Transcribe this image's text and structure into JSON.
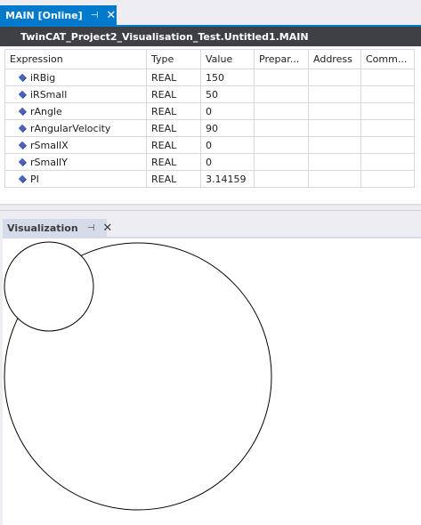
{
  "doc_tab": {
    "title": "MAIN [Online]",
    "pin_glyph": "⊣",
    "close_glyph": "✕"
  },
  "path_title": "TwinCAT_Project2_Visualisation_Test.Untitled1.MAIN",
  "watch": {
    "columns": [
      "Expression",
      "Type",
      "Value",
      "Prepar...",
      "Address",
      "Comm..."
    ],
    "rows": [
      {
        "expression": "iRBig",
        "type": "REAL",
        "value": "150"
      },
      {
        "expression": "iRSmall",
        "type": "REAL",
        "value": "50"
      },
      {
        "expression": "rAngle",
        "type": "REAL",
        "value": "0"
      },
      {
        "expression": "rAngularVelocity",
        "type": "REAL",
        "value": "90"
      },
      {
        "expression": "rSmallX",
        "type": "REAL",
        "value": "0"
      },
      {
        "expression": "rSmallY",
        "type": "REAL",
        "value": "0"
      },
      {
        "expression": "PI",
        "type": "REAL",
        "value": "3.14159"
      }
    ]
  },
  "visualization": {
    "title": "Visualization",
    "pin_glyph": "⊣",
    "close_glyph": "✕"
  },
  "colors": {
    "accent": "#007acc",
    "title_bar": "#3f3f46",
    "variable_icon": "#4a62b8"
  }
}
